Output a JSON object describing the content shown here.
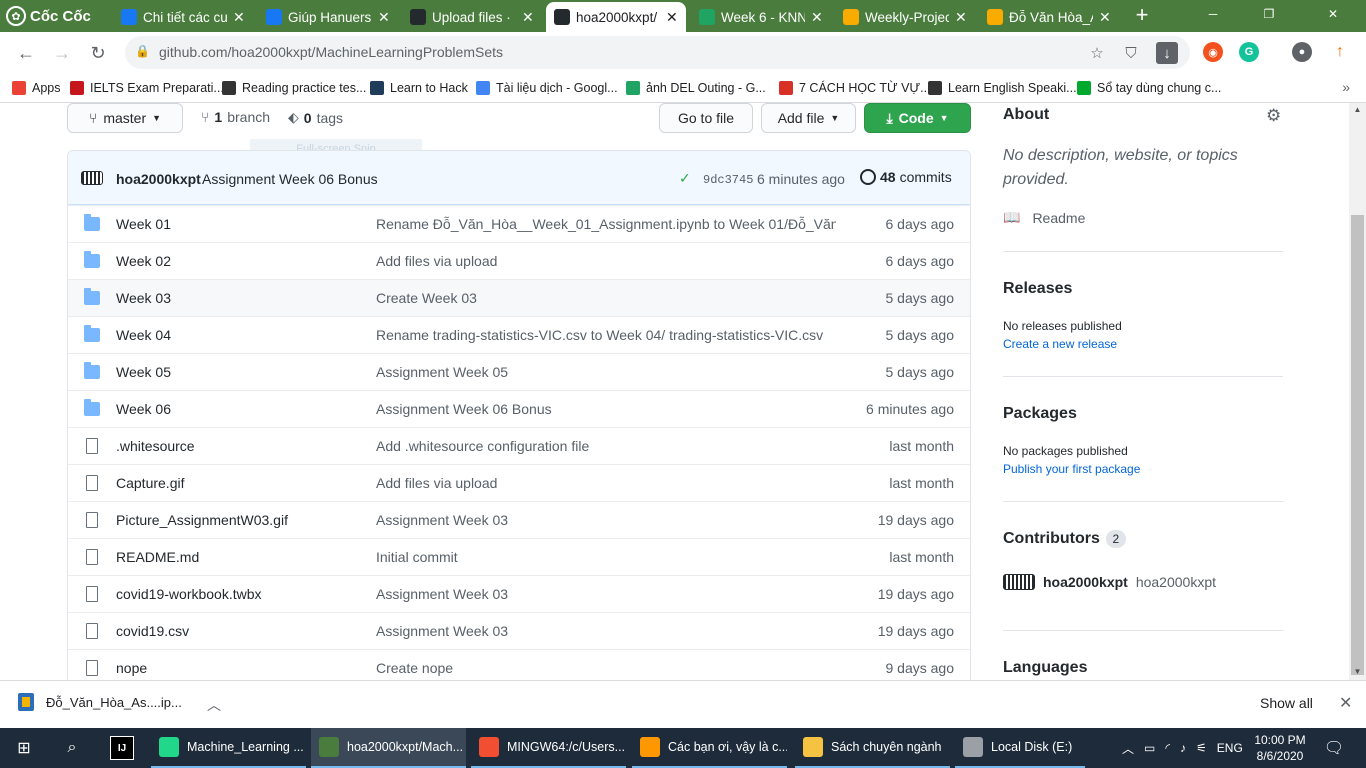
{
  "browser": {
    "brand": "Cốc Cốc",
    "tabs": [
      {
        "title": "Chi tiết các cư",
        "icon": "facebook-messenger-icon",
        "color": "#1877f2"
      },
      {
        "title": "Giúp Hanuers",
        "icon": "facebook-icon",
        "color": "#1877f2"
      },
      {
        "title": "Upload files ·",
        "icon": "github-icon",
        "color": "#24292e"
      },
      {
        "title": "hoa2000kxpt/",
        "icon": "github-icon",
        "color": "#24292e",
        "active": true
      },
      {
        "title": "Week 6 - KNN",
        "icon": "google-drive-icon",
        "color": "#1fa463"
      },
      {
        "title": "Weekly-Projec",
        "icon": "colab-icon",
        "color": "#f9ab00"
      },
      {
        "title": "Đỗ Văn Hòa_A",
        "icon": "colab-icon",
        "color": "#f9ab00"
      }
    ],
    "new_tab": "+",
    "url": "github.com/hoa2000kxpt/MachineLearningProblemSets",
    "bookmarks": [
      {
        "label": "Apps",
        "icon": "apps-grid-icon",
        "color": "#ea4335"
      },
      {
        "label": "IELTS Exam Preparati...",
        "icon": "ielts-icon",
        "color": "#c4161c"
      },
      {
        "label": "Reading practice tes...",
        "icon": "reading-icon",
        "color": "#333333"
      },
      {
        "label": "Learn to Hack",
        "icon": "hackerrank-icon",
        "color": "#1f3c5a"
      },
      {
        "label": "Tài liệu dịch - Googl...",
        "icon": "google-docs-icon",
        "color": "#4285f4"
      },
      {
        "label": "ảnh DEL Outing - G...",
        "icon": "google-drive-icon",
        "color": "#1fa463"
      },
      {
        "label": "7 CÁCH HỌC TỪ VỰ...",
        "icon": "bookmark-page-icon",
        "color": "#d93025"
      },
      {
        "label": "Learn English Speaki...",
        "icon": "globe-icon",
        "color": "#333333"
      },
      {
        "label": "Sổ tay dùng chung c...",
        "icon": "evernote-icon",
        "color": "#00a82d"
      }
    ]
  },
  "repo": {
    "branch": "master",
    "branch_count": "1",
    "branch_label": "branch",
    "tag_count": "0",
    "tag_label": "tags",
    "go_to_file": "Go to file",
    "add_file": "Add file",
    "code": "Code",
    "snip_overlay": "Full-screen Snip",
    "commit": {
      "author": "hoa2000kxpt",
      "message": "Assignment Week 06 Bonus",
      "sha": "9dc3745",
      "time": "6 minutes ago",
      "count": "48",
      "count_label": "commits"
    },
    "files": [
      {
        "type": "folder",
        "name": "Week 01",
        "message": "Rename Đỗ_Văn_Hòa__Week_01_Assignment.ipynb to Week 01/Đỗ_Văn_...",
        "age": "6 days ago"
      },
      {
        "type": "folder",
        "name": "Week 02",
        "message": "Add files via upload",
        "age": "6 days ago"
      },
      {
        "type": "folder",
        "name": "Week 03",
        "message": "Create Week 03",
        "age": "5 days ago"
      },
      {
        "type": "folder",
        "name": "Week 04",
        "message": "Rename trading-statistics-VIC.csv to Week 04/ trading-statistics-VIC.csv",
        "age": "5 days ago"
      },
      {
        "type": "folder",
        "name": "Week 05",
        "message": "Assignment Week 05",
        "age": "5 days ago"
      },
      {
        "type": "folder",
        "name": "Week 06",
        "message": "Assignment Week 06 Bonus",
        "age": "6 minutes ago"
      },
      {
        "type": "file",
        "name": ".whitesource",
        "message": "Add .whitesource configuration file",
        "age": "last month"
      },
      {
        "type": "file",
        "name": "Capture.gif",
        "message": "Add files via upload",
        "age": "last month"
      },
      {
        "type": "file",
        "name": "Picture_AssignmentW03.gif",
        "message": "Assignment Week 03",
        "age": "19 days ago"
      },
      {
        "type": "file",
        "name": "README.md",
        "message": "Initial commit",
        "age": "last month"
      },
      {
        "type": "file",
        "name": "covid19-workbook.twbx",
        "message": "Assignment Week 03",
        "age": "19 days ago"
      },
      {
        "type": "file",
        "name": "covid19.csv",
        "message": "Assignment Week 03",
        "age": "19 days ago"
      },
      {
        "type": "file",
        "name": "nope",
        "message": "Create nope",
        "age": "9 days ago"
      }
    ]
  },
  "sidebar": {
    "about_title": "About",
    "about_desc": "No description, website, or topics provided.",
    "readme": "Readme",
    "releases_title": "Releases",
    "releases_none": "No releases published",
    "releases_link": "Create a new release",
    "packages_title": "Packages",
    "packages_none": "No packages published",
    "packages_link": "Publish your first package",
    "contributors_title": "Contributors",
    "contributors_count": "2",
    "contributor_login": "hoa2000kxpt",
    "contributor_name": "hoa2000kxpt",
    "languages_title": "Languages"
  },
  "downloads": {
    "file": "Đỗ_Văn_Hòa_As....ip...",
    "show_all": "Show all"
  },
  "taskbar": {
    "apps": [
      {
        "label": "Machine_Learning ...",
        "icon": "pycharm-icon",
        "color": "#21d789"
      },
      {
        "label": "hoa2000kxpt/Mach...",
        "icon": "coccoc-browser-icon",
        "color": "#4a7c3d",
        "active": true
      },
      {
        "label": "MINGW64:/c/Users...",
        "icon": "git-bash-icon",
        "color": "#f14e32"
      },
      {
        "label": "Các bạn ơi, vậy là c...",
        "icon": "sublime-text-icon",
        "color": "#ff9800"
      },
      {
        "label": "Sách chuyên ngành",
        "icon": "folder-icon",
        "color": "#f5c242"
      },
      {
        "label": "Local Disk (E:)",
        "icon": "drive-icon",
        "color": "#9aa0a6"
      }
    ],
    "lang": "ENG",
    "time": "10:00 PM",
    "date": "8/6/2020"
  }
}
